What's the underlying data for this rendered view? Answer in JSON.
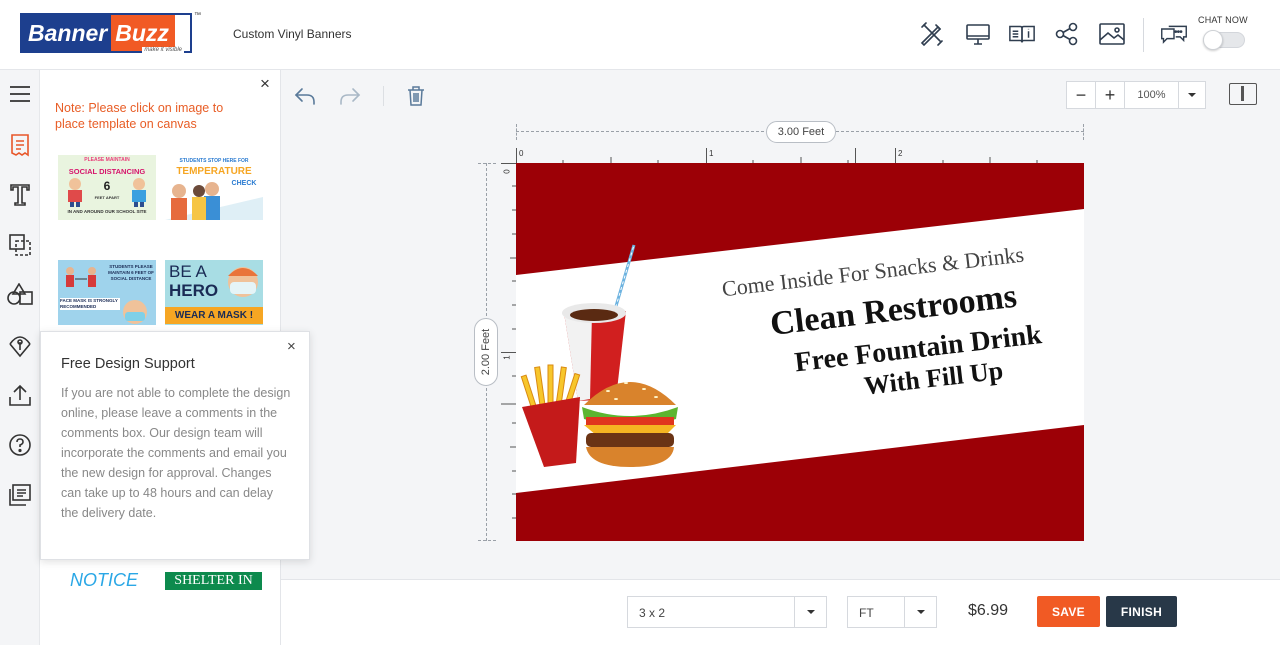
{
  "header": {
    "logo_part1": "Banner",
    "logo_part2": "Buzz",
    "logo_tagline": "make it visible",
    "logo_tm": "™",
    "product_title": "Custom Vinyl Banners",
    "chat_label": "CHAT NOW",
    "icons": [
      "design-tools-icon",
      "preview-desktop-icon",
      "catalog-icon",
      "share-icon",
      "image-icon",
      "chat-icon"
    ]
  },
  "rail": {
    "icons": [
      "menu-icon",
      "templates-icon",
      "text-icon",
      "layers-icon",
      "shapes-icon",
      "clipart-icon",
      "upload-icon",
      "help-icon",
      "comments-icon"
    ]
  },
  "template_panel": {
    "close": "×",
    "note": "Note: Please click on image to place template on canvas",
    "templates": [
      {
        "line1": "PLEASE MAINTAIN",
        "line2": "SOCIAL DISTANCING",
        "line3": "6",
        "line4": "FEET APART",
        "line5": "IN AND AROUND OUR SCHOOL SITE"
      },
      {
        "line1": "STUDENTS STOP HERE FOR",
        "line2": "TEMPERATURE",
        "line3": "CHECK"
      },
      {
        "line1": "STUDENTS PLEASE MAINTAIN 6 FEET OF SOCIAL DISTANCE",
        "line2": "FACE MASK IS STRONGLY RECOMMENDED"
      },
      {
        "line1": "BE A",
        "line2": "HERO",
        "line3": "WEAR A MASK !"
      },
      {
        "line1": "NOTICE"
      },
      {
        "line1": "SHELTER IN PLACE"
      }
    ]
  },
  "support_popup": {
    "close": "×",
    "title": "Free Design Support",
    "body": "If you are not able to complete the design online, please leave a comments in the comments box. Our design team will incorporate the comments and email you the new design for approval. Changes can take up to 48 hours and can delay the delivery date."
  },
  "toolbar": {
    "icons": [
      "undo-icon",
      "redo-icon",
      "delete-icon"
    ],
    "zoom_minus": "−",
    "zoom_plus": "+",
    "zoom_value": "100%"
  },
  "canvas": {
    "width_label": "3.00 Feet",
    "height_label": "2.00 Feet",
    "ruler_h": [
      "0",
      "1",
      "2"
    ],
    "ruler_v": [
      "0",
      "1"
    ],
    "banner": {
      "line1": "Come Inside For Snacks & Drinks",
      "line2": "Clean Restrooms",
      "line3": "Free Fountain Drink",
      "line4": "With Fill Up",
      "background_color": "#9c0006"
    }
  },
  "bottom_bar": {
    "size_value": "3 x 2",
    "unit_value": "FT",
    "price": "$6.99",
    "save_label": "SAVE",
    "finish_label": "FINISH"
  },
  "colors": {
    "accent_orange": "#f15a24",
    "brand_blue": "#1d3f8e",
    "dark_button": "#283848",
    "note_text": "#e85d26"
  }
}
